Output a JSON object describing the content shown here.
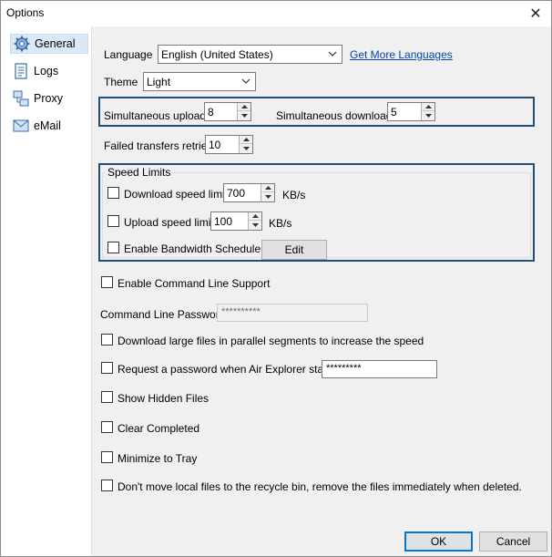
{
  "window": {
    "title": "Options"
  },
  "sidebar": {
    "items": [
      {
        "label": "General",
        "icon": "gear-icon",
        "selected": true
      },
      {
        "label": "Logs",
        "icon": "document-icon",
        "selected": false
      },
      {
        "label": "Proxy",
        "icon": "network-icon",
        "selected": false
      },
      {
        "label": "eMail",
        "icon": "envelope-icon",
        "selected": false
      }
    ]
  },
  "general": {
    "language_label": "Language",
    "language_value": "English (United States)",
    "more_languages_link": "Get More Languages",
    "theme_label": "Theme",
    "theme_value": "Light",
    "uploads_label": "Simultaneous uploads",
    "uploads_value": "8",
    "downloads_label": "Simultaneous downloads",
    "downloads_value": "5",
    "retries_label": "Failed transfers retries",
    "retries_value": "10"
  },
  "speed_limits": {
    "title": "Speed Limits",
    "download_label": "Download speed limit",
    "download_value": "700",
    "download_unit": "KB/s",
    "upload_label": "Upload speed limit",
    "upload_value": "100",
    "upload_unit": "KB/s",
    "scheduler_label": "Enable Bandwidth Scheduler",
    "edit_label": "Edit"
  },
  "options": {
    "command_line_label": "Enable Command Line Support",
    "command_password_label": "Command Line Password",
    "command_password_value": "**********",
    "parallel_label": "Download large files in parallel segments to increase the speed",
    "request_password_label": "Request a password when Air Explorer starts",
    "request_password_value": "*********",
    "hidden_files_label": "Show Hidden Files",
    "clear_completed_label": "Clear Completed",
    "minimize_label": "Minimize to Tray",
    "recycle_label": "Don't move local files to the recycle bin, remove the files immediately when deleted."
  },
  "footer": {
    "ok_label": "OK",
    "cancel_label": "Cancel"
  },
  "colors": {
    "highlight": "#1f4e79",
    "link": "#0645ad",
    "selected": "#dbe9f7"
  }
}
